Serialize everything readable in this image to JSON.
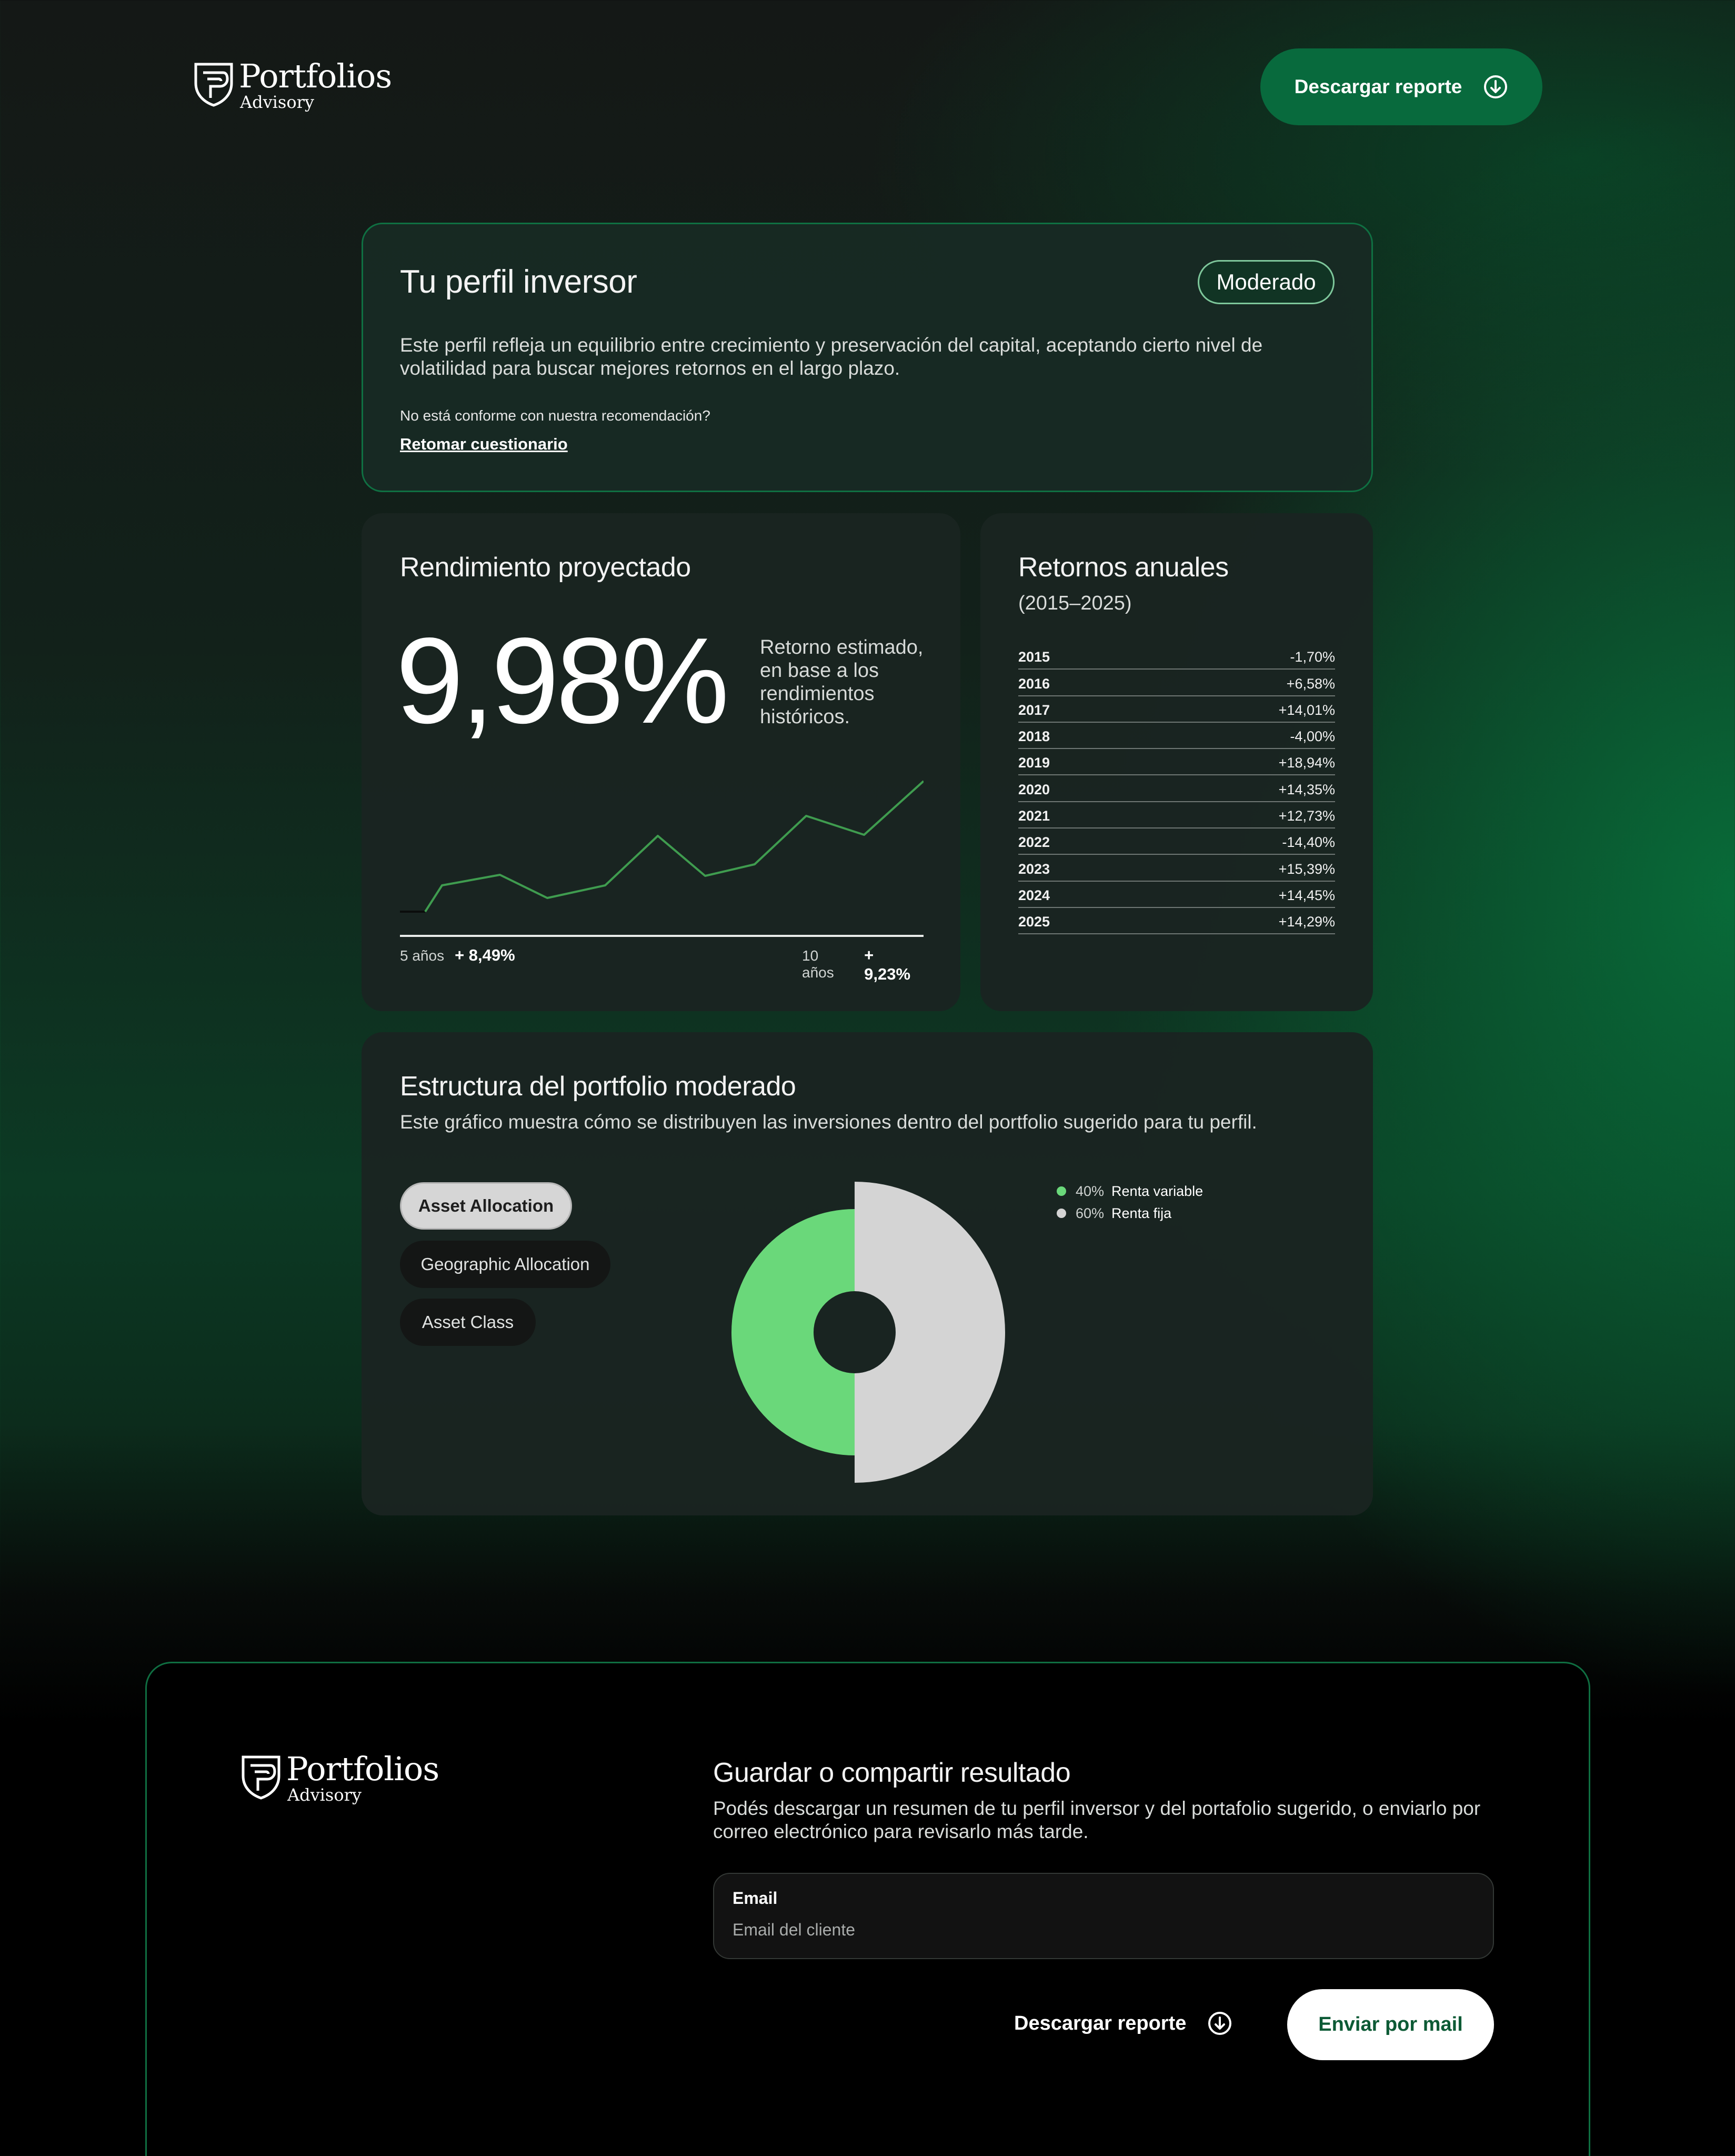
{
  "header": {
    "logo_name": "Portfolios",
    "logo_sub": "Advisory",
    "download_label": "Descargar reporte",
    "download_icon": "download-circle-icon"
  },
  "profile": {
    "title": "Tu perfil inversor",
    "badge": "Moderado",
    "description": "Este perfil refleja un equilibrio entre crecimiento y preservación del capital, aceptando cierto nivel de volatilidad para buscar mejores retornos en el largo plazo.",
    "question": "No está conforme con nuestra recomendación?",
    "retake_link": "Retomar cuestionario"
  },
  "projection": {
    "title": "Rendimiento proyectado",
    "value": "9,98%",
    "description": "Retorno estimado, en base a los rendimientos históricos.",
    "left_label": "5 años",
    "left_value": "+ 8,49%",
    "right_label": "10 años",
    "right_value": "+ 9,23%"
  },
  "annual": {
    "title": "Retornos anuales",
    "subtitle": "(2015–2025)",
    "rows": [
      {
        "year": "2015",
        "value": "-1,70%"
      },
      {
        "year": "2016",
        "value": "+6,58%"
      },
      {
        "year": "2017",
        "value": "+14,01%"
      },
      {
        "year": "2018",
        "value": "-4,00%"
      },
      {
        "year": "2019",
        "value": "+18,94%"
      },
      {
        "year": "2020",
        "value": "+14,35%"
      },
      {
        "year": "2021",
        "value": "+12,73%"
      },
      {
        "year": "2022",
        "value": "-14,40%"
      },
      {
        "year": "2023",
        "value": "+15,39%"
      },
      {
        "year": "2024",
        "value": "+14,45%"
      },
      {
        "year": "2025",
        "value": "+14,29%"
      }
    ]
  },
  "structure": {
    "title": "Estructura del portfolio moderado",
    "description": "Este gráfico muestra cómo se distribuyen las inversiones dentro del portfolio sugerido para tu perfil.",
    "tabs": [
      {
        "label": "Asset Allocation",
        "active": true
      },
      {
        "label": "Geographic Allocation",
        "active": false
      },
      {
        "label": "Asset Class",
        "active": false
      }
    ],
    "legend": [
      {
        "pct": "40%",
        "label": "Renta variable",
        "color": "#6ad87a"
      },
      {
        "pct": "60%",
        "label": "Renta fija",
        "color": "#d4d4d4"
      }
    ]
  },
  "footer": {
    "logo_name": "Portfolios",
    "logo_sub": "Advisory",
    "title": "Guardar o compartir resultado",
    "description": "Podés descargar un resumen de tu perfil inversor y del portafolio sugerido, o enviarlo por correo electrónico para revisarlo más tarde.",
    "email_label": "Email",
    "email_placeholder": "Email del cliente",
    "download_label": "Descargar reporte",
    "send_label": "Enviar por mail"
  },
  "colors": {
    "accent": "#086a3d",
    "line": "#3f9c4f",
    "equity": "#6ad87a",
    "fixed": "#d4d4d4"
  }
}
